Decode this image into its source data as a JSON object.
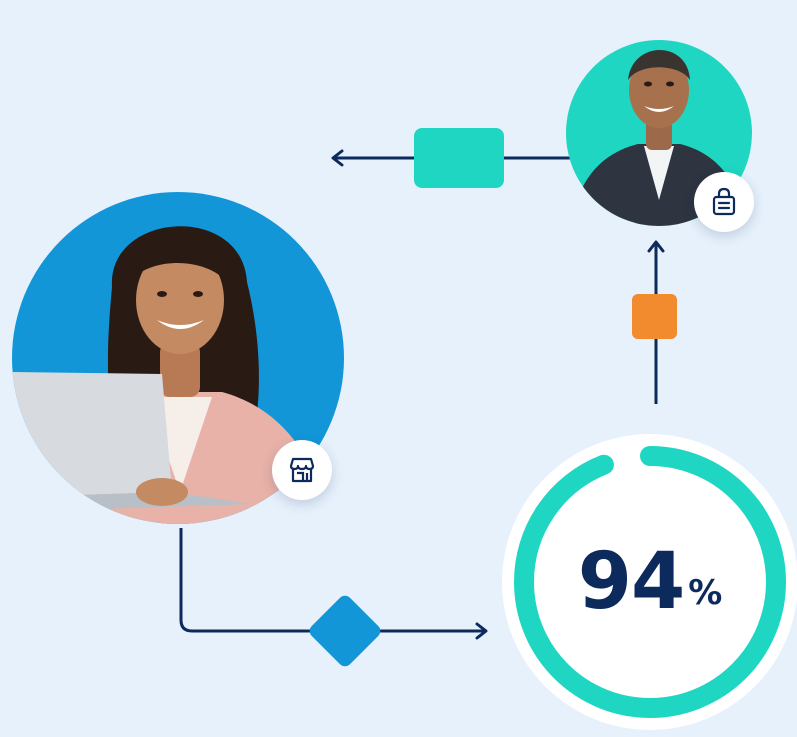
{
  "colors": {
    "background": "#e6f1fc",
    "connector": "#0d2a5c",
    "merchant_circle": "#1296d8",
    "buyer_circle": "#1fd6c2",
    "teal_node": "#1fd6c2",
    "orange_node": "#f28a2e",
    "blue_node": "#1296d8",
    "gauge_ring": "#1fd6c2",
    "gauge_text": "#0d2a5c"
  },
  "merchant": {
    "badge_icon": "storefront-icon"
  },
  "buyer": {
    "badge_icon": "shopping-bag-icon"
  },
  "gauge": {
    "value": 94,
    "value_text": "94",
    "unit": "%"
  }
}
